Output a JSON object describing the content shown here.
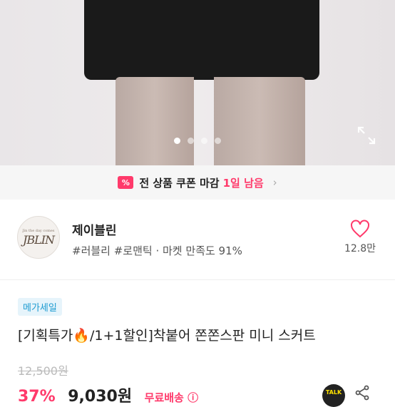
{
  "gallery": {
    "dots_total": 4,
    "active_index": 0,
    "expand_icon": "expand-icon"
  },
  "coupon": {
    "icon": "coupon-ticket-icon",
    "ticket_glyph": "%",
    "text": "전 상품 쿠폰 마감",
    "highlight": "1일 남음",
    "chevron": "›"
  },
  "store": {
    "logo_top": "Jin the day comes",
    "logo_main": "JBLIN",
    "name": "제이블린",
    "tags": "#러블리 #로맨틱 · 마켓 만족도 91%",
    "like_icon": "heart-icon",
    "likes": "12.8만"
  },
  "product": {
    "badge": "메가세일",
    "title": "[기획특가🔥/1+1할인]착붙어 쫀쫀스판 미니 스커트",
    "original_price": "12,500원",
    "discount": "37%",
    "price": "9,030원",
    "shipping": "무료배송 ⓘ"
  },
  "actions": {
    "talk_label": "TALK",
    "share_icon": "share-icon"
  },
  "colors": {
    "accent": "#ff3a6b",
    "badge_text": "#1d9bd1",
    "badge_bg": "#e6f4fb"
  }
}
